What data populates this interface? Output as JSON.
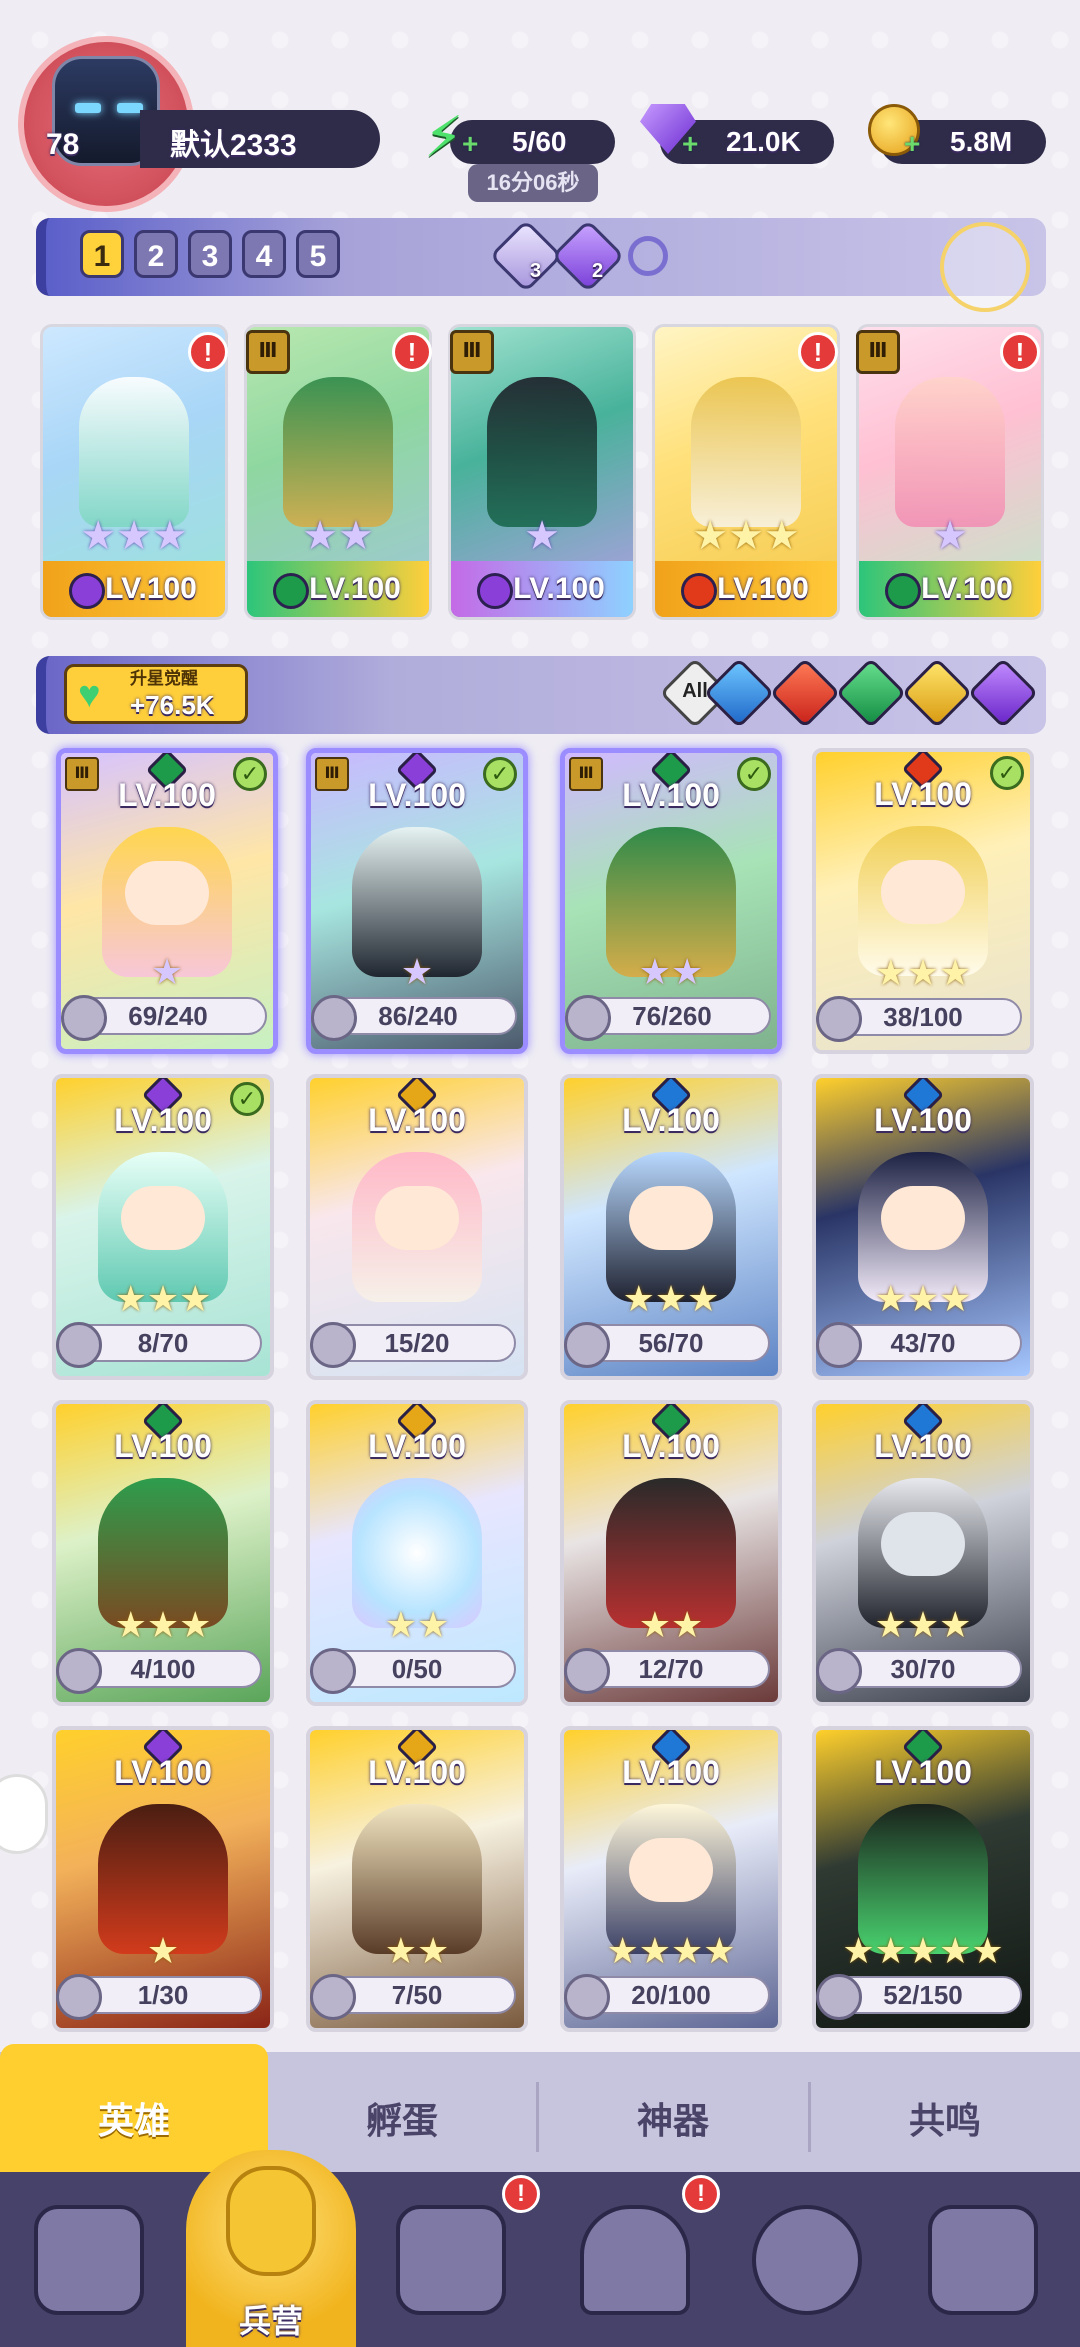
{
  "player": {
    "level": "78",
    "name": "默认2333"
  },
  "resources": {
    "energy": "5/60",
    "energy_timer": "16分06秒",
    "gems": "21.0K",
    "gold": "5.8M"
  },
  "team_tabs": [
    "1",
    "2",
    "3",
    "4",
    "5"
  ],
  "team_gems": {
    "a_count": "3",
    "b_count": "2"
  },
  "team": [
    {
      "level": "LV.100",
      "stars": "★★★",
      "element_color": "#8b3fd9"
    },
    {
      "level": "LV.100",
      "stars": "★★",
      "element_color": "#1d9a4a"
    },
    {
      "level": "LV.100",
      "stars": "★",
      "element_color": "#8b3fd9"
    },
    {
      "level": "LV.100",
      "stars": "★★★",
      "element_color": "#e03a1a"
    },
    {
      "level": "LV.100",
      "stars": "★",
      "element_color": "#1d9a4a"
    }
  ],
  "upgrade": {
    "title": "升星觉醒",
    "value": "+76.5K"
  },
  "filters": {
    "all_label": "All"
  },
  "heroes": [
    {
      "level": "LV.100",
      "frag": "69/240",
      "stars": "★"
    },
    {
      "level": "LV.100",
      "frag": "86/240",
      "stars": "★"
    },
    {
      "level": "LV.100",
      "frag": "76/260",
      "stars": "★★"
    },
    {
      "level": "LV.100",
      "frag": "38/100",
      "stars": "★★★"
    },
    {
      "level": "LV.100",
      "frag": "8/70",
      "stars": "★★★"
    },
    {
      "level": "LV.100",
      "frag": "15/20",
      "stars": ""
    },
    {
      "level": "LV.100",
      "frag": "56/70",
      "stars": "★★★"
    },
    {
      "level": "LV.100",
      "frag": "43/70",
      "stars": "★★★"
    },
    {
      "level": "LV.100",
      "frag": "4/100",
      "stars": "★★★"
    },
    {
      "level": "LV.100",
      "frag": "0/50",
      "stars": "★★"
    },
    {
      "level": "LV.100",
      "frag": "12/70",
      "stars": "★★"
    },
    {
      "level": "LV.100",
      "frag": "30/70",
      "stars": "★★★"
    },
    {
      "level": "LV.100",
      "frag": "1/30",
      "stars": "★"
    },
    {
      "level": "LV.100",
      "frag": "7/50",
      "stars": "★★"
    },
    {
      "level": "LV.100",
      "frag": "20/100",
      "stars": "★★★★"
    },
    {
      "level": "LV.100",
      "frag": "52/150",
      "stars": "★★★★★"
    }
  ],
  "tabs": [
    "英雄",
    "孵蛋",
    "神器",
    "共鸣"
  ],
  "nav": {
    "main_label": "兵营",
    "alert": "!"
  },
  "alert_mark": "!",
  "rank_mark": "Ⅲ",
  "check_mark": "✓",
  "colors": {
    "accent": "#ffcf2f",
    "dark": "#2f2c49",
    "nav": "#46426a"
  }
}
